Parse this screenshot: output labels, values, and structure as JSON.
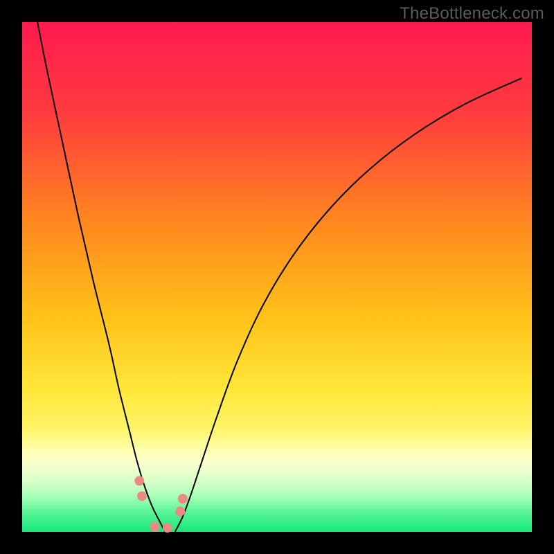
{
  "watermark": "TheBottleneck.com",
  "colors": {
    "frame": "#000000",
    "curve": "#000000",
    "marker": "#e98b80",
    "gradient_stops": [
      {
        "pos": 0,
        "color": "#ff1a4f"
      },
      {
        "pos": 18,
        "color": "#ff3b3e"
      },
      {
        "pos": 40,
        "color": "#ff8a1e"
      },
      {
        "pos": 58,
        "color": "#ffc21a"
      },
      {
        "pos": 72,
        "color": "#ffe63a"
      },
      {
        "pos": 80,
        "color": "#fff56a"
      },
      {
        "pos": 84,
        "color": "#ffffb0"
      },
      {
        "pos": 87,
        "color": "#f6ffd0"
      },
      {
        "pos": 90,
        "color": "#d8ffc8"
      },
      {
        "pos": 93,
        "color": "#a8ffb8"
      },
      {
        "pos": 96,
        "color": "#5cf598"
      },
      {
        "pos": 100,
        "color": "#14e87a"
      }
    ]
  },
  "chart_data": {
    "type": "line",
    "title": "",
    "xlabel": "",
    "ylabel": "",
    "xlim": [
      0,
      100
    ],
    "ylim": [
      0,
      100
    ],
    "grid": false,
    "legend": false,
    "series": [
      {
        "name": "left-curve",
        "x": [
          3,
          5,
          8,
          11,
          14,
          17,
          19,
          21,
          22.5,
          24,
          25.5,
          27,
          28
        ],
        "y": [
          100,
          90,
          76,
          62,
          49,
          37,
          28,
          20,
          14,
          9,
          5,
          2,
          0
        ]
      },
      {
        "name": "right-curve",
        "x": [
          30,
          31.5,
          33,
          35,
          38,
          42,
          47,
          53,
          60,
          68,
          77,
          87,
          98
        ],
        "y": [
          0,
          3,
          7,
          13,
          22,
          33,
          44,
          54,
          63,
          71,
          78,
          84,
          89
        ]
      }
    ],
    "markers": [
      {
        "x": 23.0,
        "y": 10.0
      },
      {
        "x": 23.5,
        "y": 7.0
      },
      {
        "x": 26.0,
        "y": 1.0
      },
      {
        "x": 28.5,
        "y": 0.8
      },
      {
        "x": 31.0,
        "y": 4.0
      },
      {
        "x": 31.5,
        "y": 6.5
      }
    ],
    "marker_radius_px": 7
  }
}
